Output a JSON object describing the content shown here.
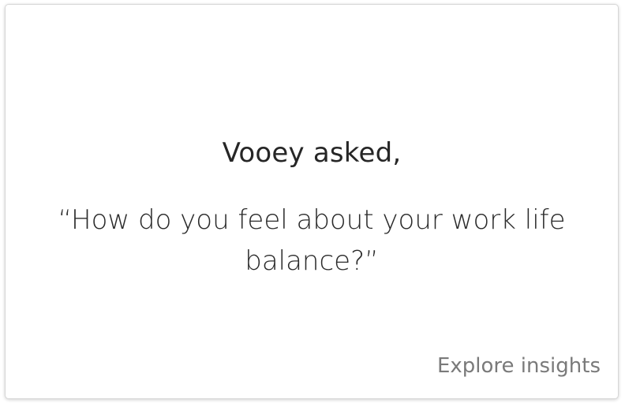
{
  "card": {
    "asker": "Vooey asked,",
    "question": "“How do you feel about your work life balance?”",
    "explore_link": "Explore insights"
  },
  "colors": {
    "text_primary": "#262626",
    "text_secondary": "#7a7a7a",
    "card_border": "#d6d6d6"
  }
}
